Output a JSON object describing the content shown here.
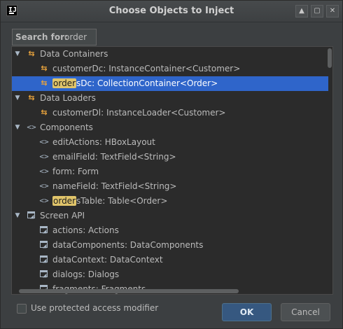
{
  "window": {
    "title": "Choose Objects to Inject"
  },
  "search": {
    "label": "Search for:",
    "value": "order"
  },
  "tree": {
    "data_containers": {
      "label": "Data Containers",
      "items": [
        {
          "label": "customerDc: InstanceContainer<Customer>"
        },
        {
          "prefix": "",
          "match": "order",
          "suffix": "sDc: CollectionContainer<Order>"
        }
      ]
    },
    "data_loaders": {
      "label": "Data Loaders",
      "items": [
        {
          "label": "customerDl: InstanceLoader<Customer>"
        }
      ]
    },
    "components": {
      "label": "Components",
      "items": [
        {
          "label": "editActions: HBoxLayout"
        },
        {
          "label": "emailField: TextField<String>"
        },
        {
          "label": "form: Form"
        },
        {
          "label": "nameField: TextField<String>"
        },
        {
          "prefix": "",
          "match": "order",
          "suffix": "sTable: Table<Order>"
        }
      ]
    },
    "screen_api": {
      "label": "Screen API",
      "items": [
        {
          "label": "actions: Actions"
        },
        {
          "label": "dataComponents: DataComponents"
        },
        {
          "label": "dataContext: DataContext"
        },
        {
          "label": "dialogs: Dialogs"
        },
        {
          "label": "fragments: Fragments"
        }
      ]
    }
  },
  "options": {
    "protected_label": "Use protected access modifier"
  },
  "buttons": {
    "ok": "OK",
    "cancel": "Cancel"
  },
  "icons": {
    "expanded": "triangle-down",
    "data": "data-container-icon",
    "component": "component-icon",
    "screen_api": "screen-api-icon"
  },
  "colors": {
    "selection": "#2f65ca",
    "highlight": "#e0c46a",
    "ok_button": "#365880"
  }
}
